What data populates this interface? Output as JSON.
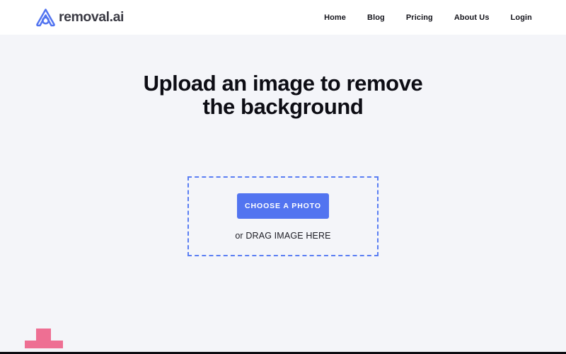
{
  "header": {
    "brand": {
      "icon": "removal-ai-logo-icon",
      "text": "removal.ai"
    },
    "nav": [
      {
        "label": "Home"
      },
      {
        "label": "Blog"
      },
      {
        "label": "Pricing"
      },
      {
        "label": "About Us"
      },
      {
        "label": "Login"
      }
    ]
  },
  "hero": {
    "headline": "Upload an image to remove the background",
    "dropzone": {
      "button_label": "CHOOSE A PHOTO",
      "drag_hint": "or DRAG IMAGE HERE"
    }
  },
  "colors": {
    "page_background": "#f4f5f9",
    "header_background": "#ffffff",
    "brand_blue": "#5274f0",
    "dropzone_border": "#5a7ef3",
    "headline_text": "#0d0d14",
    "brand_text": "#3b3b44",
    "accent_pink": "#ee6f93",
    "bottom_rule": "#0b0b10"
  }
}
